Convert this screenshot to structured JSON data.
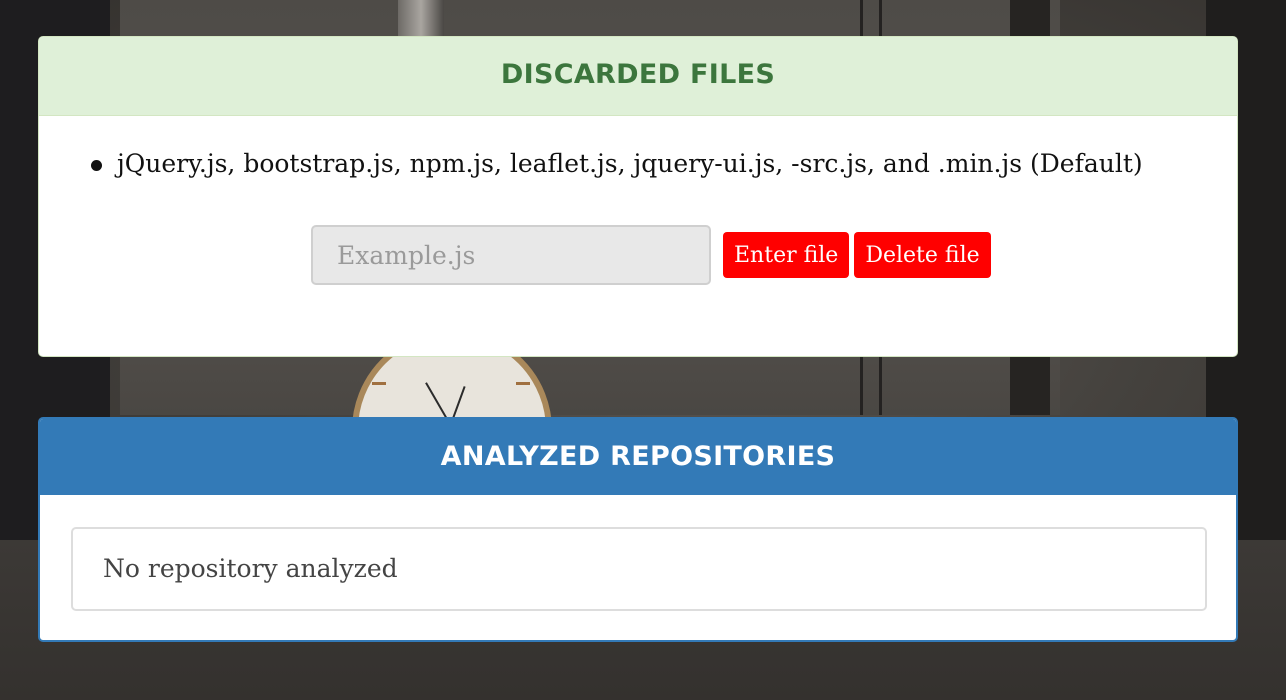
{
  "discarded_files": {
    "title": "DISCARDED FILES",
    "items": [
      "jQuery.js, bootstrap.js, npm.js, leaflet.js, jquery-ui.js, -src.js, and .min.js (Default)"
    ],
    "input": {
      "placeholder": "Example.js",
      "value": ""
    },
    "enter_button": "Enter file",
    "delete_button": "Delete file"
  },
  "analyzed_repositories": {
    "title": "ANALYZED REPOSITORIES",
    "empty_message": "No repository analyzed"
  },
  "colors": {
    "success_heading_bg": "#dff0d8",
    "success_heading_text": "#3c763d",
    "primary_heading_bg": "#337ab7",
    "button_red": "#ff0000"
  }
}
